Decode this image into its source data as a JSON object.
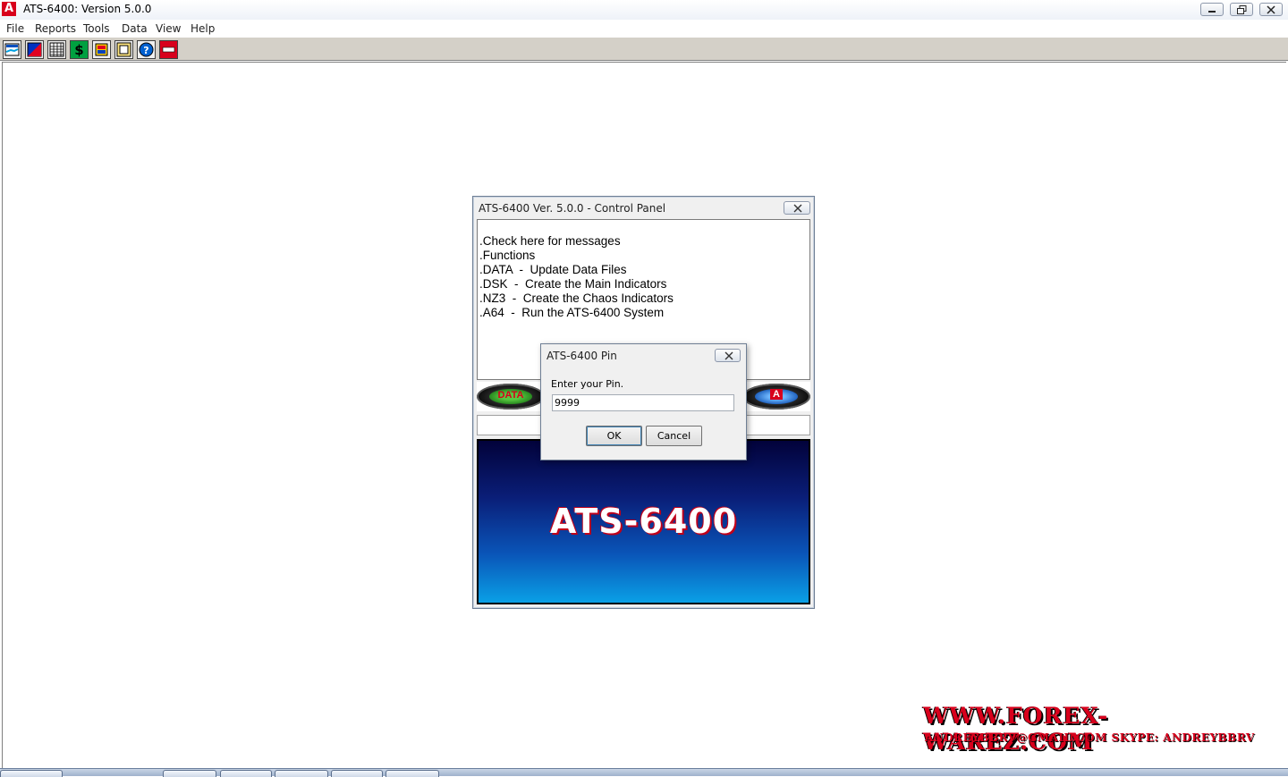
{
  "window": {
    "title": "ATS-6400: Version 5.0.0",
    "app_icon_letter": "A",
    "brand_color": "#d8001c"
  },
  "menu": [
    "File",
    "Reports",
    "Tools",
    "Data",
    "View",
    "Help"
  ],
  "toolbar": {
    "buttons": [
      "chart-icon",
      "gradient-chart-icon",
      "grid-icon",
      "dollar-icon",
      "palette-icon",
      "window-icon",
      "help-icon",
      "stop-icon"
    ]
  },
  "control_panel": {
    "title": "ATS-6400 Ver. 5.0.0 -  Control Panel",
    "messages": [
      ".Check here for messages",
      "",
      ".Functions",
      ".DATA  -  Update Data Files",
      ".DSK  -  Create the Main Indicators",
      ".NZ3  -  Create the Chaos Indicators",
      ".A64  -  Run the ATS-6400 System"
    ],
    "data_button_label": "DATA",
    "a64_button_label": "A",
    "banner_text": "ATS-6400"
  },
  "pin_dialog": {
    "title": "ATS-6400 Pin",
    "prompt": "Enter your Pin.",
    "pin_value": "9999",
    "ok_label": "OK",
    "cancel_label": "Cancel"
  },
  "watermark": {
    "site": "WWW.FOREX-WAREZ.COM",
    "contact": "ANDREYBBRV@GMAIL.COM  SKYPE: ANDREYBBRV"
  }
}
